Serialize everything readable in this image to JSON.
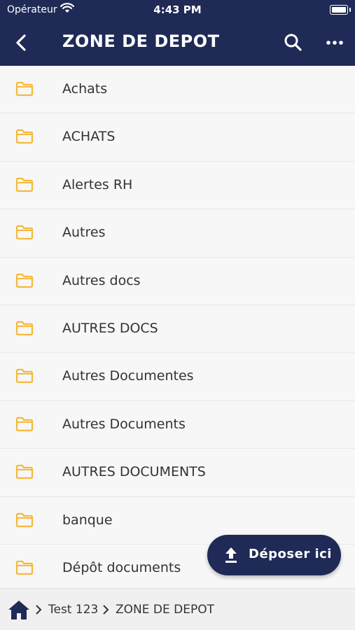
{
  "status_bar": {
    "carrier": "Opérateur",
    "time": "4:43 PM"
  },
  "header": {
    "title": "ZONE DE DEPOT"
  },
  "folders": [
    "Achats",
    "ACHATS",
    "Alertes RH",
    "Autres",
    "Autres docs",
    "AUTRES DOCS",
    "Autres Documentes",
    "Autres Documents",
    "AUTRES DOCUMENTS",
    "banque",
    "Dépôt documents"
  ],
  "fab": {
    "label": "Déposer ici"
  },
  "breadcrumb": {
    "items": [
      "Test 123",
      "ZONE DE DEPOT"
    ]
  },
  "colors": {
    "primary": "#1f2a56",
    "folder": "#f5b93a",
    "background": "#f7f7f7"
  }
}
